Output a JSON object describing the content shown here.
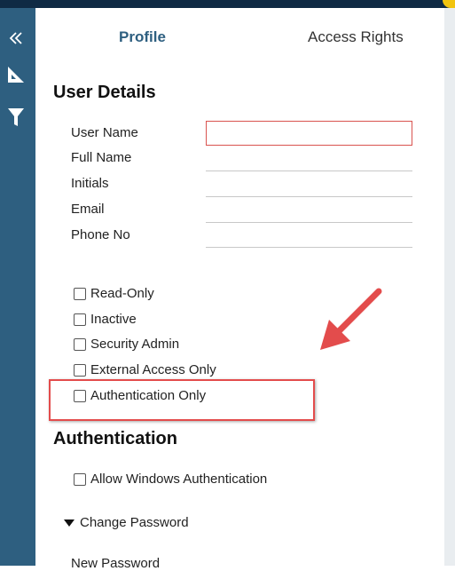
{
  "tabs": {
    "profile": "Profile",
    "access_rights": "Access Rights"
  },
  "sidebar": {
    "icons": [
      "collapse-double-chevron-icon",
      "set-square-icon",
      "filter-icon"
    ]
  },
  "user_details": {
    "title": "User Details",
    "fields": [
      {
        "label": "User Name",
        "value": ""
      },
      {
        "label": "Full Name",
        "value": ""
      },
      {
        "label": "Initials",
        "value": ""
      },
      {
        "label": "Email",
        "value": ""
      },
      {
        "label": "Phone No",
        "value": ""
      }
    ],
    "checkboxes": [
      {
        "label": "Read-Only",
        "checked": false
      },
      {
        "label": "Inactive",
        "checked": false
      },
      {
        "label": "Security Admin",
        "checked": false
      },
      {
        "label": "External Access Only",
        "checked": false
      },
      {
        "label": "Authentication Only",
        "checked": false
      }
    ]
  },
  "authentication": {
    "title": "Authentication",
    "allow_windows": "Allow Windows Authentication",
    "change_password": "Change Password",
    "new_password": "New Password"
  },
  "colors": {
    "sidebar": "#2e5f80",
    "topbar": "#0f2a44",
    "highlight": "#e34c4c",
    "tab_active": "#2e5f80"
  }
}
